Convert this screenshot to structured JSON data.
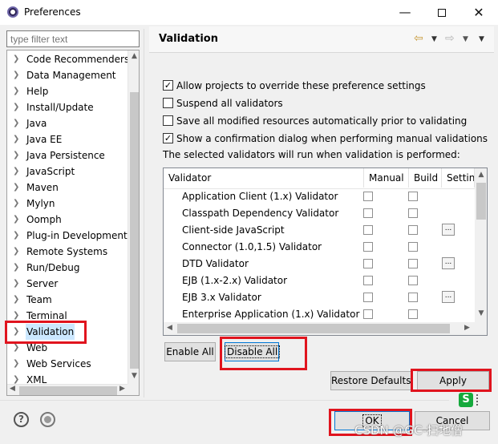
{
  "window": {
    "title": "Preferences",
    "minimize": "—",
    "close": "✕"
  },
  "sidebar": {
    "filter_placeholder": "type filter text",
    "items": [
      {
        "label": "Code Recommenders"
      },
      {
        "label": "Data Management"
      },
      {
        "label": "Help"
      },
      {
        "label": "Install/Update"
      },
      {
        "label": "Java"
      },
      {
        "label": "Java EE"
      },
      {
        "label": "Java Persistence"
      },
      {
        "label": "JavaScript"
      },
      {
        "label": "Maven"
      },
      {
        "label": "Mylyn"
      },
      {
        "label": "Oomph"
      },
      {
        "label": "Plug-in Development"
      },
      {
        "label": "Remote Systems"
      },
      {
        "label": "Run/Debug"
      },
      {
        "label": "Server"
      },
      {
        "label": "Team"
      },
      {
        "label": "Terminal"
      },
      {
        "label": "Validation",
        "selected": true
      },
      {
        "label": "Web"
      },
      {
        "label": "Web Services"
      },
      {
        "label": "XML"
      }
    ]
  },
  "page": {
    "title": "Validation",
    "options": [
      {
        "label": "Allow projects to override these preference settings",
        "checked": true
      },
      {
        "label": "Suspend all validators",
        "checked": false
      },
      {
        "label": "Save all modified resources automatically prior to validating",
        "checked": false
      },
      {
        "label": "Show a confirmation dialog when performing manual validations",
        "checked": true
      }
    ],
    "description": "The selected validators will run when validation is performed:",
    "table": {
      "headers": [
        "Validator",
        "Manual",
        "Build",
        "Settings"
      ],
      "rows": [
        {
          "name": "Application Client (1.x) Validator",
          "settings": false
        },
        {
          "name": "Classpath Dependency Validator",
          "settings": false
        },
        {
          "name": "Client-side JavaScript",
          "settings": true
        },
        {
          "name": "Connector (1.0,1.5) Validator",
          "settings": false
        },
        {
          "name": "DTD Validator",
          "settings": true
        },
        {
          "name": "EJB (1.x-2.x) Validator",
          "settings": false
        },
        {
          "name": "EJB 3.x Validator",
          "settings": true
        },
        {
          "name": "Enterprise Application (1.x) Validator",
          "settings": false
        }
      ],
      "settings_button": "..."
    },
    "enable_all": "Enable All",
    "disable_all": "Disable All",
    "restore_defaults": "Restore Defaults",
    "apply": "Apply"
  },
  "footer": {
    "ok": "OK",
    "cancel": "Cancel",
    "help_icon_glyph": "?"
  },
  "watermark": "CSDN @GC-扫地僧",
  "colors": {
    "highlight": "#e0141e",
    "selection": "#cce8ff",
    "accent": "#0078d7"
  }
}
